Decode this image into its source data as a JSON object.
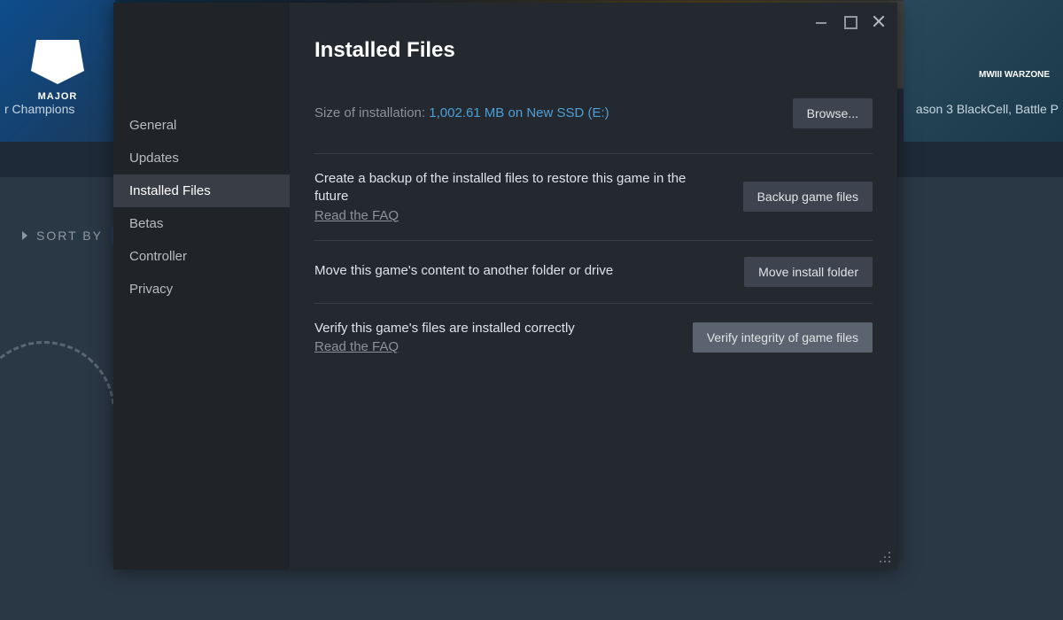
{
  "backdrop": {
    "left_game_logo_text": "MAJOR",
    "left_game_label": "r Champions",
    "right_game_brand": "MWIII WARZONE",
    "right_game_label": "ason 3 BlackCell, Battle P",
    "sort_by_label": "SORT BY",
    "sort_by_value": "Al"
  },
  "window": {
    "title": "Installed Files",
    "size_label": "Size of installation: ",
    "size_value": "1,002.61 MB on New SSD (E:)",
    "browse_button": "Browse...",
    "faq_link": "Read the FAQ",
    "sidebar": {
      "items": [
        {
          "label": "General"
        },
        {
          "label": "Updates"
        },
        {
          "label": "Installed Files"
        },
        {
          "label": "Betas"
        },
        {
          "label": "Controller"
        },
        {
          "label": "Privacy"
        }
      ],
      "active_index": 2
    },
    "options": {
      "backup": {
        "desc": "Create a backup of the installed files to restore this game in the future",
        "button": "Backup game files"
      },
      "move": {
        "desc": "Move this game's content to another folder or drive",
        "button": "Move install folder"
      },
      "verify": {
        "desc": "Verify this game's files are installed correctly",
        "button": "Verify integrity of game files"
      }
    }
  }
}
